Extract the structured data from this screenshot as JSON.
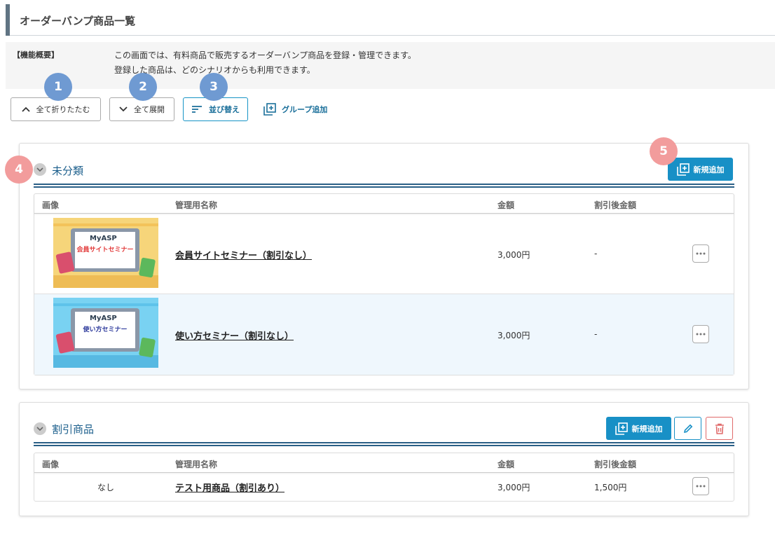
{
  "page": {
    "title": "オーダーバンプ商品一覧"
  },
  "summary": {
    "label": "【機能概要】",
    "line1": "この画面では、有料商品で販売するオーダーバンプ商品を登録・管理できます。",
    "line2": "登録した商品は、どのシナリオからも利用できます。"
  },
  "toolbar": {
    "collapse_all": "全て折りたたむ",
    "expand_all": "全て展開",
    "sort": "並び替え",
    "add_group": "グループ追加"
  },
  "badges": [
    "1",
    "2",
    "3",
    "4",
    "5"
  ],
  "table_headers": {
    "image": "画像",
    "name": "管理用名称",
    "price": "金額",
    "discount_price": "割引後金額"
  },
  "groups": [
    {
      "name": "未分類",
      "add_label": "新規追加",
      "rows": [
        {
          "thumb_brand": "MyASP",
          "thumb_caption": "会員サイトセミナー",
          "name": "会員サイトセミナー（割引なし）",
          "price": "3,000円",
          "discount_price": "-"
        },
        {
          "thumb_brand": "MyASP",
          "thumb_caption": "使い方セミナー",
          "name": "使い方セミナー（割引なし）",
          "price": "3,000円",
          "discount_price": "-"
        }
      ]
    },
    {
      "name": "割引商品",
      "add_label": "新規追加",
      "rows": [
        {
          "image_text": "なし",
          "name": "テスト用商品（割引あり）",
          "price": "3,000円",
          "discount_price": "1,500円"
        }
      ]
    }
  ],
  "colors": {
    "accent": "#1890c6",
    "group_title": "#1c5f8c",
    "badge_blue": "#6f9ad2",
    "badge_pink": "#f29c9c",
    "danger": "#e06a6a"
  }
}
